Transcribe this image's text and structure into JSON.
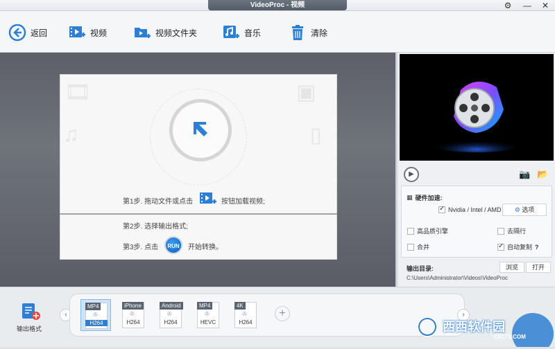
{
  "window": {
    "title": "VideoProc - 视频"
  },
  "toolbar": {
    "back_label": "返回",
    "video_label": "视频",
    "folder_label": "视频文件夹",
    "music_label": "音乐",
    "clear_label": "清除"
  },
  "steps": {
    "step1": "第1步. 拖动文件或点击",
    "step1_suffix": "按钮加载视频;",
    "step2": "第2步. 选择输出格式;",
    "step3": "第3步. 点击",
    "step3_suffix": "开始转换。",
    "run_label": "RUN"
  },
  "options": {
    "hw_accel_label": "硬件加速:",
    "gpu_label": "Nvidia / Intel / AMD",
    "options_button": "选项",
    "hq_engine": "高品质引擎",
    "deinterlace": "去隔行",
    "merge": "合并",
    "auto_copy": "自动复制",
    "help_mark": "?",
    "gpu_checked": true,
    "auto_copy_checked": true
  },
  "output": {
    "dir_label": "输出目录:",
    "path": "C:\\Users\\Administrator\\Videos\\VideoProc",
    "browse_button": "浏览",
    "open_button": "打开"
  },
  "bottom": {
    "output_format_label": "输出格式",
    "formats": [
      {
        "top": "MP4",
        "codec": "H264",
        "selected": true
      },
      {
        "top": "iPhone",
        "codec": "H264",
        "selected": false
      },
      {
        "top": "Android",
        "codec": "H264",
        "selected": false
      },
      {
        "top": "MP4",
        "codec": "HEVC",
        "selected": false
      },
      {
        "top": "4K",
        "codec": "H264",
        "selected": false
      }
    ],
    "add_symbol": "+"
  },
  "watermark": {
    "text": "西西软件园",
    "sub": "CR173.COM"
  },
  "colors": {
    "accent": "#2f7fd1",
    "drop_bg": "#666a72",
    "title_bar": "#5d6570"
  }
}
